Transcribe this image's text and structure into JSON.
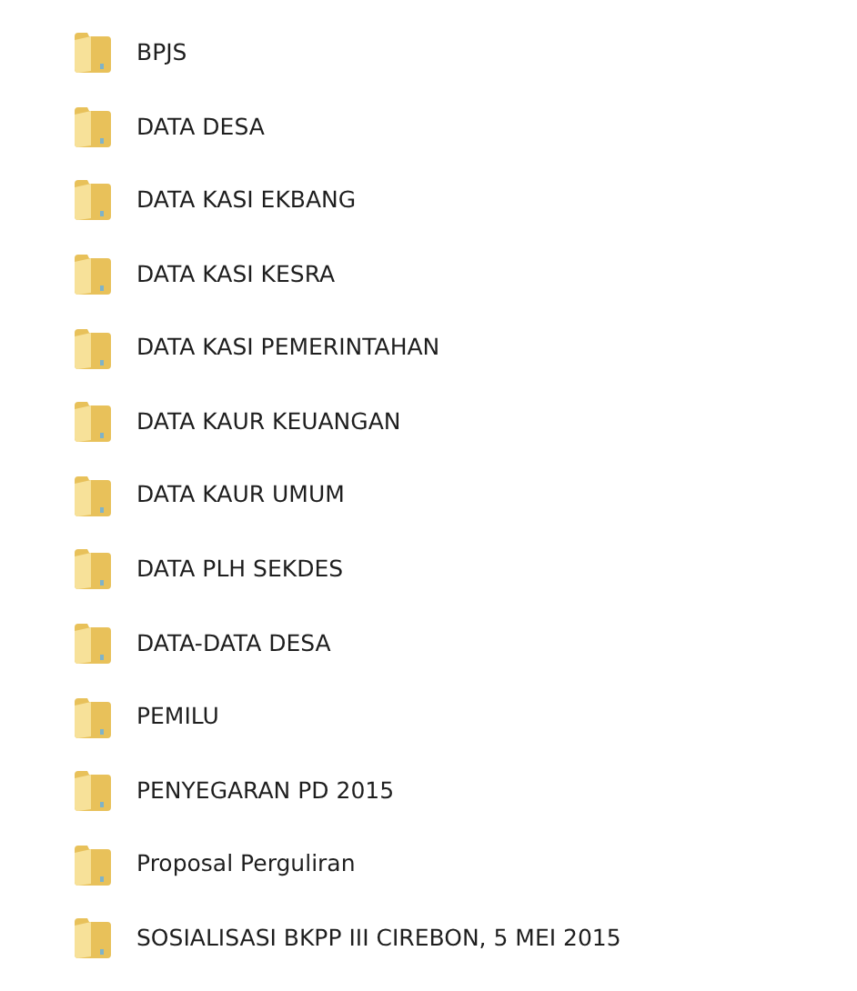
{
  "folders": [
    {
      "name": "BPJS"
    },
    {
      "name": "DATA DESA"
    },
    {
      "name": "DATA KASI EKBANG"
    },
    {
      "name": "DATA KASI KESRA"
    },
    {
      "name": "DATA KASI PEMERINTAHAN"
    },
    {
      "name": "DATA KAUR KEUANGAN"
    },
    {
      "name": "DATA KAUR UMUM"
    },
    {
      "name": "DATA PLH SEKDES"
    },
    {
      "name": "DATA-DATA DESA"
    },
    {
      "name": "PEMILU"
    },
    {
      "name": "PENYEGARAN PD 2015"
    },
    {
      "name": "Proposal Perguliran"
    },
    {
      "name": "SOSIALISASI BKPP III CIREBON, 5 MEI 2015"
    }
  ]
}
